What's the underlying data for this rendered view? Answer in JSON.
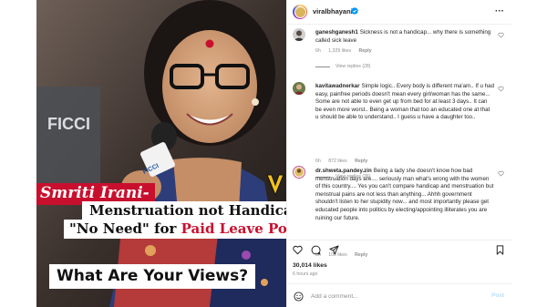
{
  "post": {
    "caption_name": "Smriti Irani-",
    "caption_line1": "Menstruation not Handicap",
    "caption_line2_prefix": "\"No Need\" for ",
    "caption_line2_highlight": "Paid Leave Policy",
    "caption_question": "What Are Your Views?",
    "backdrop_text": "FICCI",
    "mic_label": "FICCI",
    "accent_red": "#c8102e"
  },
  "header": {
    "username": "viralbhayani",
    "more_icon": "more-horizontal-icon"
  },
  "comments": [
    {
      "username": "ganeshganesh1",
      "text": "Sickness is not a handicap... why there is something called sick leave",
      "age": "6h",
      "likes": "1,329 likes",
      "reply": "Reply",
      "view_replies": "View replies (28)"
    },
    {
      "username": "kavitawadnerkar",
      "text": "Simple logic.. Every body is different ma'am.. If u had easy, painfree periods doesn't mean every girl/woman has the same... Some are not able to even get up from bed for at least 3 days.. It can be even more worst.. Being a woman that too an educated one at that u should be able to understand.. I guess u have a daughter too..",
      "age": "6h",
      "likes": "872 likes",
      "reply": "Reply",
      "view_replies": "View replies (36)"
    },
    {
      "username": "dr.shweta.pandey.zin",
      "text": "Being a lady she doesn't know how bad menstruation days are.... seriously man what's wrong with the women of this country.... Yes you can't compare handicap and menstruation but menstrual pains are not less than anything... Ahhh government shouldn't listen to her stupidity now... and most importantly please get educated people into politics by electing/appointing illiterates you are ruining our future.",
      "age": "5h",
      "likes": "100 likes",
      "reply": "Reply"
    }
  ],
  "stats": {
    "likes": "30,014 likes",
    "time_ago": "6 hours ago"
  },
  "composer": {
    "placeholder": "Add a comment...",
    "post_label": "Post"
  },
  "colors": {
    "muted": "#8e8e8e",
    "text": "#262626",
    "link_disabled": "#b2dffc"
  }
}
